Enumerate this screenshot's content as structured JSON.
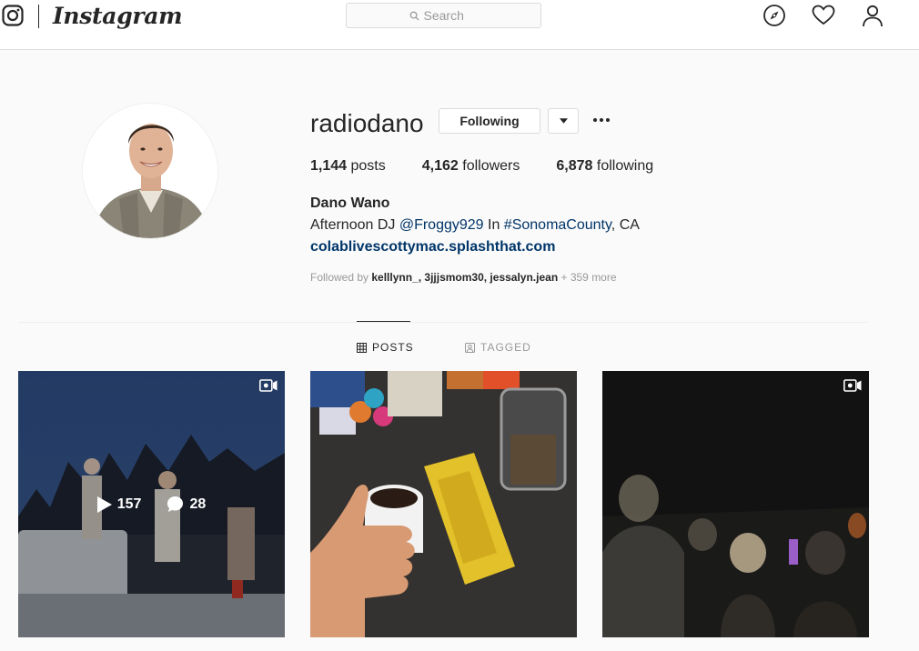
{
  "nav": {
    "wordmark": "Instagram",
    "search_placeholder": "Search",
    "icons": [
      "instagram-glyph-icon",
      "search-icon",
      "explore-compass-icon",
      "activity-heart-icon",
      "profile-person-icon"
    ]
  },
  "profile": {
    "username": "radiodano",
    "following_button": "Following",
    "stats": {
      "posts_count": "1,144",
      "posts_label": "posts",
      "followers_count": "4,162",
      "followers_label": "followers",
      "following_count": "6,878",
      "following_label": "following"
    },
    "full_name": "Dano Wano",
    "bio": {
      "prefix": "Afternoon DJ ",
      "mention": "@Froggy929",
      "middle": " In ",
      "hashtag": "#SonomaCounty",
      "suffix": ", CA"
    },
    "website": "colablivescottymac.splashthat.com",
    "followed_by": {
      "label": "Followed by ",
      "names": "kelllynn_, 3jjjsmom30, jessalyn.jean",
      "more": " + 359 more"
    }
  },
  "tabs": [
    {
      "label": "POSTS",
      "active": true
    },
    {
      "label": "TAGGED",
      "active": false
    }
  ],
  "posts": [
    {
      "type": "video",
      "hover": true,
      "plays": "157",
      "comments": "28"
    },
    {
      "type": "photo",
      "hover": false
    },
    {
      "type": "video",
      "hover": false
    }
  ],
  "colors": {
    "link": "#003569",
    "border": "#dbdbdb",
    "text": "#262626",
    "muted": "#999999",
    "background": "#fafafa"
  }
}
